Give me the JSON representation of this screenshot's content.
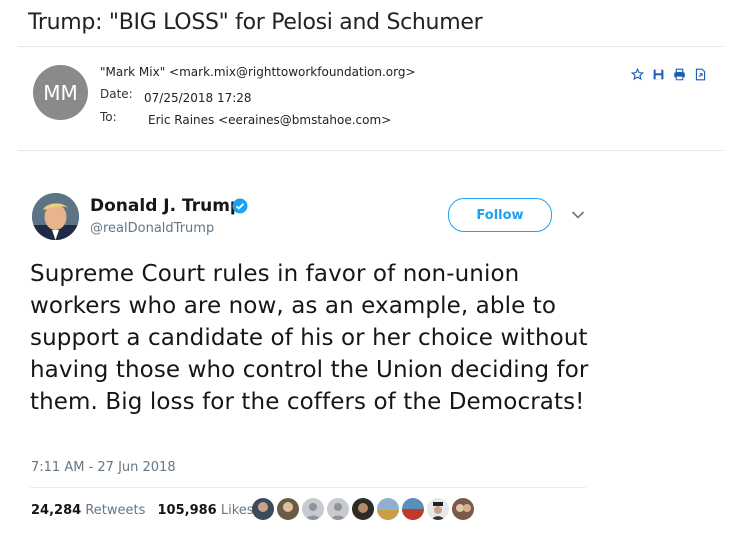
{
  "email": {
    "subject": "Trump: \"BIG LOSS\" for Pelosi and Schumer",
    "sender_initials": "MM",
    "from": "\"Mark Mix\" <mark.mix@righttoworkfoundation.org>",
    "date_label": "Date:",
    "date_value": "07/25/2018 17:28",
    "to_label": "To:",
    "to_value": "Eric Raines <eeraines@bmstahoe.com>",
    "actions": [
      "star-icon",
      "save-icon",
      "print-icon",
      "export-icon"
    ]
  },
  "tweet": {
    "display_name": "Donald J. Trump",
    "handle": "@realDonaldTrump",
    "follow_label": "Follow",
    "text": "Supreme Court rules in favor of non-union workers who are now, as an example, able to support a candidate of his or her choice without having those who control the Union deciding for them. Big loss for the coffers of the Democrats!",
    "timestamp": "7:11 AM - 27 Jun 2018",
    "retweets_count": "24,284",
    "retweets_label": "Retweets",
    "likes_count": "105,986",
    "likes_label": "Likes"
  },
  "colors": {
    "twitter_blue": "#1da1f2",
    "secondary_text": "#657786",
    "email_icon_blue": "#1a5fb4"
  }
}
